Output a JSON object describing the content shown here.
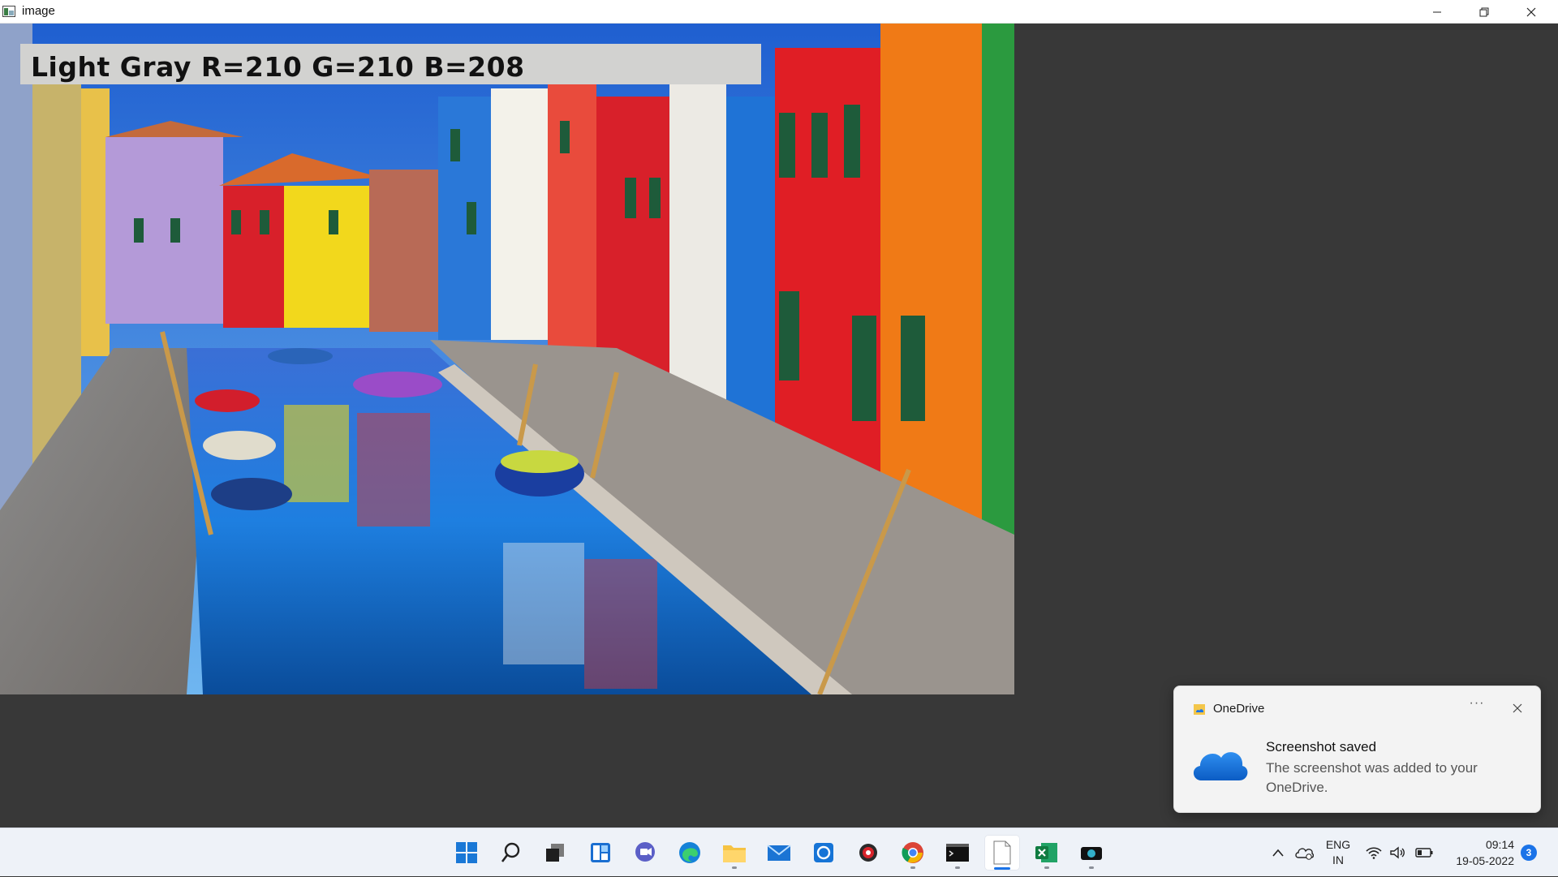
{
  "window": {
    "title": "image",
    "controls": [
      "minimize-icon",
      "restore-icon",
      "close-icon"
    ]
  },
  "image_overlay": {
    "label": "Light Gray R=210 G=210 B=208"
  },
  "colors": {
    "background": "#383838",
    "overlay_bg": "#d2d2d0",
    "taskbar": "#eef2f8",
    "accent": "#1a73e8"
  },
  "toast": {
    "app_name": "OneDrive",
    "more_label": "···",
    "title": "Screenshot saved",
    "body": "The screenshot was added to your OneDrive."
  },
  "taskbar": {
    "apps": [
      {
        "name": "start-icon"
      },
      {
        "name": "search-icon"
      },
      {
        "name": "task-view-icon"
      },
      {
        "name": "widgets-icon"
      },
      {
        "name": "chat-icon"
      },
      {
        "name": "edge-icon"
      },
      {
        "name": "file-explorer-icon",
        "running": true
      },
      {
        "name": "mail-icon"
      },
      {
        "name": "app-icon"
      },
      {
        "name": "settings-app-icon"
      },
      {
        "name": "chrome-icon",
        "running": true
      },
      {
        "name": "terminal-icon",
        "running": true
      },
      {
        "name": "notepad-icon",
        "active": true
      },
      {
        "name": "excel-icon",
        "running": true
      },
      {
        "name": "camera-icon",
        "running": true
      }
    ]
  },
  "tray": {
    "language_line1": "ENG",
    "language_line2": "IN",
    "time": "09:14",
    "date": "19-05-2022",
    "notification_count": "3"
  }
}
